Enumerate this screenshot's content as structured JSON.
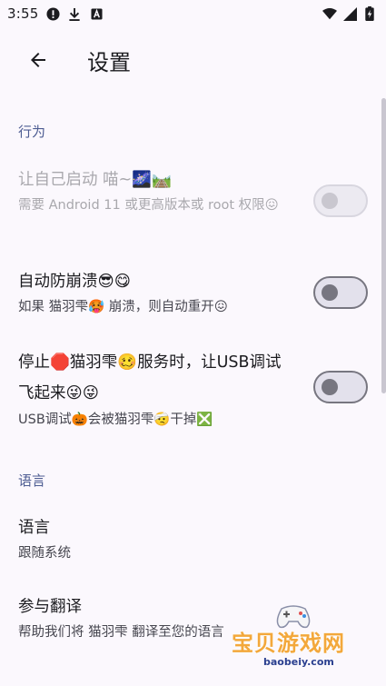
{
  "status_bar": {
    "time": "3:55",
    "icons_left": [
      "alert-circle-icon",
      "download-icon",
      "a-box-icon"
    ],
    "icons_right": [
      "wifi-icon",
      "signal-icon",
      "battery-charging-icon"
    ]
  },
  "app_bar": {
    "title": "设置",
    "back_icon": "arrow-back-icon"
  },
  "sections": [
    {
      "header": "行为"
    },
    {
      "header": "语言"
    }
  ],
  "prefs": {
    "self_start": {
      "title": "让自己启动 喵~🌌🛤️",
      "summary": "需要 Android 11 或更高版本或 root 权限😖",
      "enabled": false,
      "checked": false
    },
    "anti_crash": {
      "title": "自动防崩溃😎😋",
      "summary": "如果 猫羽雫🥵 崩溃，则自动重开😖",
      "checked": false
    },
    "usb_debug": {
      "title": "停止🛑猫羽雫🥴服务时，让USB调试飞起来😜😜",
      "summary": "USB调试🎃会被猫羽雫🤕干掉❎",
      "checked": false
    },
    "language": {
      "title": "语言",
      "summary": "跟随系统"
    },
    "translate": {
      "title": "参与翻译",
      "summary": "帮助我们将 猫羽雫 翻译至您的语言"
    }
  },
  "watermark": {
    "text": "宝贝游戏网",
    "url": "baobeiy.com"
  },
  "colors": {
    "background": "#fbf8fd",
    "accent": "#4d5c92",
    "switch_outline": "#777680"
  }
}
